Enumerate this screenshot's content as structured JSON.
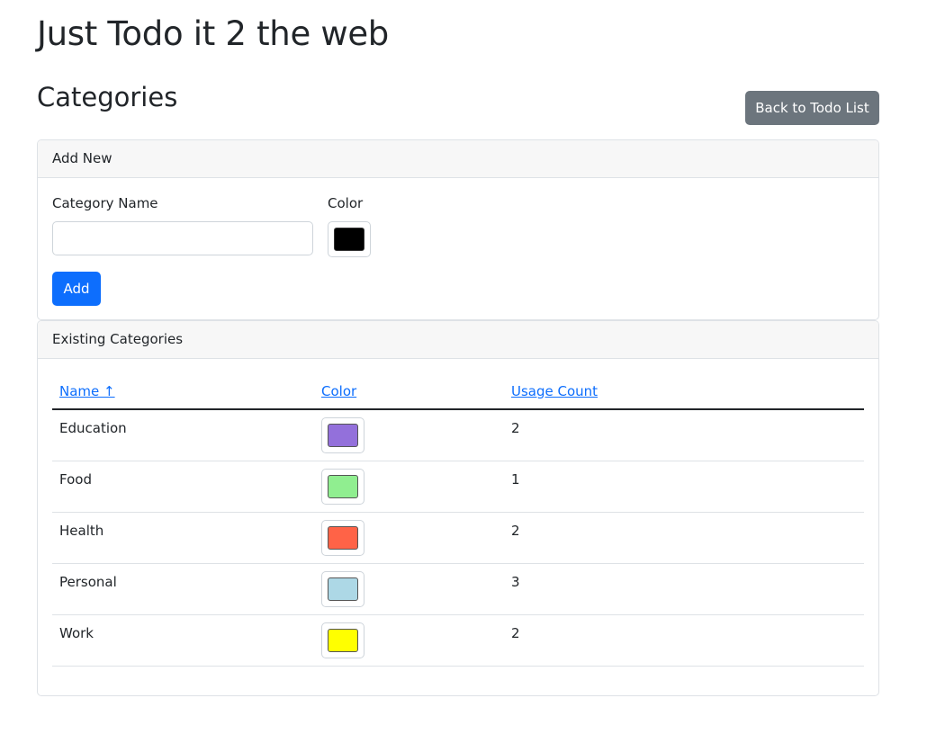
{
  "header": {
    "app_title": "Just Todo it 2 the web",
    "section_title": "Categories",
    "back_button_label": "Back to Todo List"
  },
  "add_form": {
    "card_title": "Add New",
    "name_label": "Category Name",
    "name_value": "",
    "color_label": "Color",
    "color_value": "#000000",
    "add_button_label": "Add"
  },
  "category_table": {
    "card_title": "Existing Categories",
    "columns": {
      "name": "Name ↑",
      "color": "Color",
      "usage": "Usage Count"
    },
    "rows": [
      {
        "name": "Education",
        "color": "#9370DB",
        "usage": "2"
      },
      {
        "name": "Food",
        "color": "#90EE90",
        "usage": "1"
      },
      {
        "name": "Health",
        "color": "#FF6347",
        "usage": "2"
      },
      {
        "name": "Personal",
        "color": "#ADD8E6",
        "usage": "3"
      },
      {
        "name": "Work",
        "color": "#FFFF00",
        "usage": "2"
      }
    ]
  }
}
